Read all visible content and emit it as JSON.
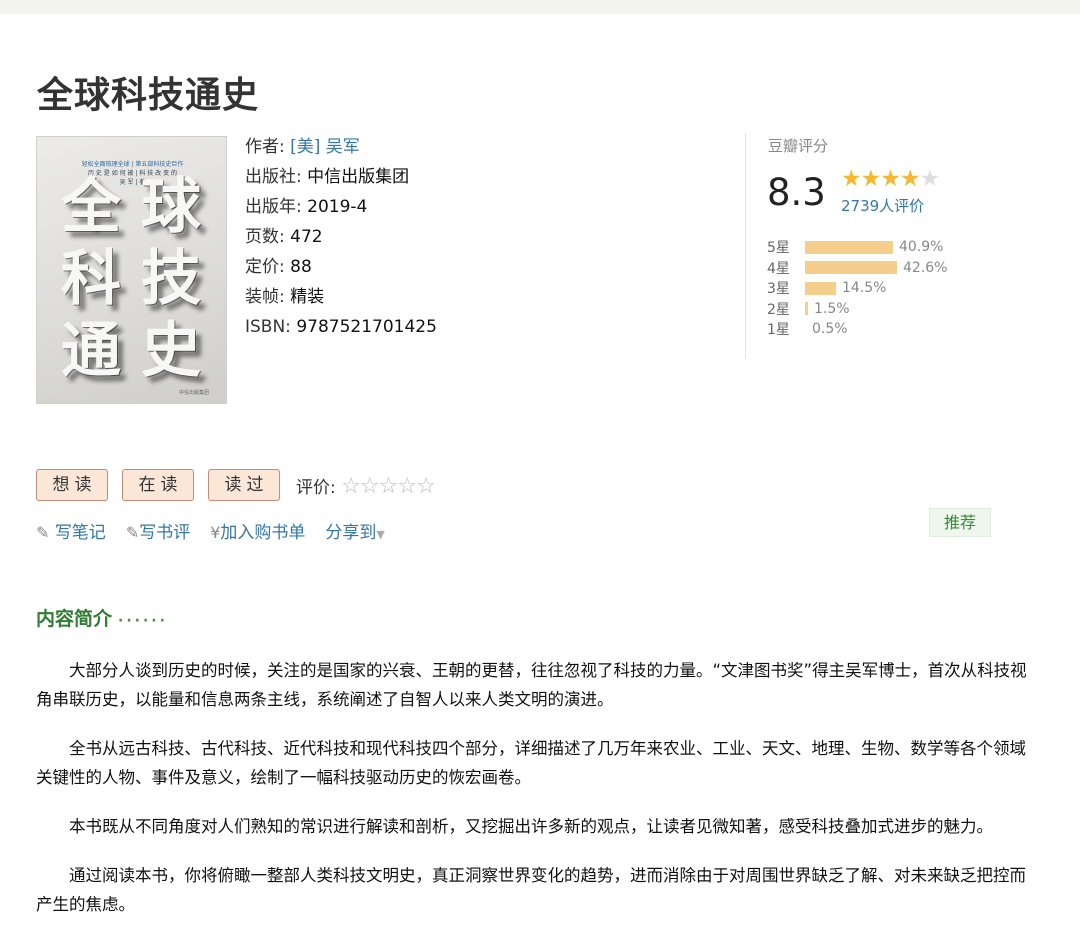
{
  "book": {
    "title": "全球科技通史",
    "cover": {
      "chars": [
        "全",
        "球",
        "科",
        "技",
        "通",
        "史"
      ],
      "tagline1": "轻松全面梳理全球 | 第五部科技史巨作",
      "tagline2": "历 史 是 如 何 被 | 科 技 改 变 的",
      "tagline3": "吴 军 | 著",
      "publisher_mark": "中信出版集团"
    },
    "info": {
      "author_label": "作者: ",
      "author_value": "[美] 吴军",
      "publisher_label": "出版社: ",
      "publisher_value": "中信出版集团",
      "year_label": "出版年: ",
      "year_value": "2019-4",
      "pages_label": "页数: ",
      "pages_value": "472",
      "price_label": "定价: ",
      "price_value": "88",
      "binding_label": "装帧: ",
      "binding_value": "精装",
      "isbn_label": "ISBN: ",
      "isbn_value": "9787521701425"
    }
  },
  "rating": {
    "label": "豆瓣评分",
    "score": "8.3",
    "stars": 4,
    "count": "2739人评价",
    "distribution": [
      {
        "label": "5星",
        "pct": "40.9%",
        "value": 40.9
      },
      {
        "label": "4星",
        "pct": "42.6%",
        "value": 42.6
      },
      {
        "label": "3星",
        "pct": "14.5%",
        "value": 14.5
      },
      {
        "label": "2星",
        "pct": "1.5%",
        "value": 1.5
      },
      {
        "label": "1星",
        "pct": "0.5%",
        "value": 0.5
      }
    ],
    "star_color": "#f7b72e"
  },
  "buttons": {
    "want": "想读",
    "reading": "在读",
    "read": "读过",
    "my_rating_label": "评价: "
  },
  "actions": {
    "note": "写笔记",
    "review": "写书评",
    "cart": "加入购书单",
    "share": "分享到",
    "recommend": "推荐"
  },
  "intro": {
    "heading": "内容简介",
    "dots": "······",
    "paragraphs": [
      "大部分人谈到历史的时候，关注的是国家的兴衰、王朝的更替，往往忽视了科技的力量。“文津图书奖”得主吴军博士，首次从科技视角串联历史，以能量和信息两条主线，系统阐述了自智人以来人类文明的演进。",
      "全书从远古科技、古代科技、近代科技和现代科技四个部分，详细描述了几万年来农业、工业、天文、地理、生物、数学等各个领域关键性的人物、事件及意义，绘制了一幅科技驱动历史的恢宏画卷。",
      "本书既从不同角度对人们熟知的常识进行解读和剖析，又挖掘出许多新的观点，让读者见微知著，感受科技叠加式进步的魅力。",
      "通过阅读本书，你将俯瞰一整部人类科技文明史，真正洞察世界变化的趋势，进而消除由于对周围世界缺乏了解、对未来缺乏把控而产生的焦虑。"
    ]
  }
}
